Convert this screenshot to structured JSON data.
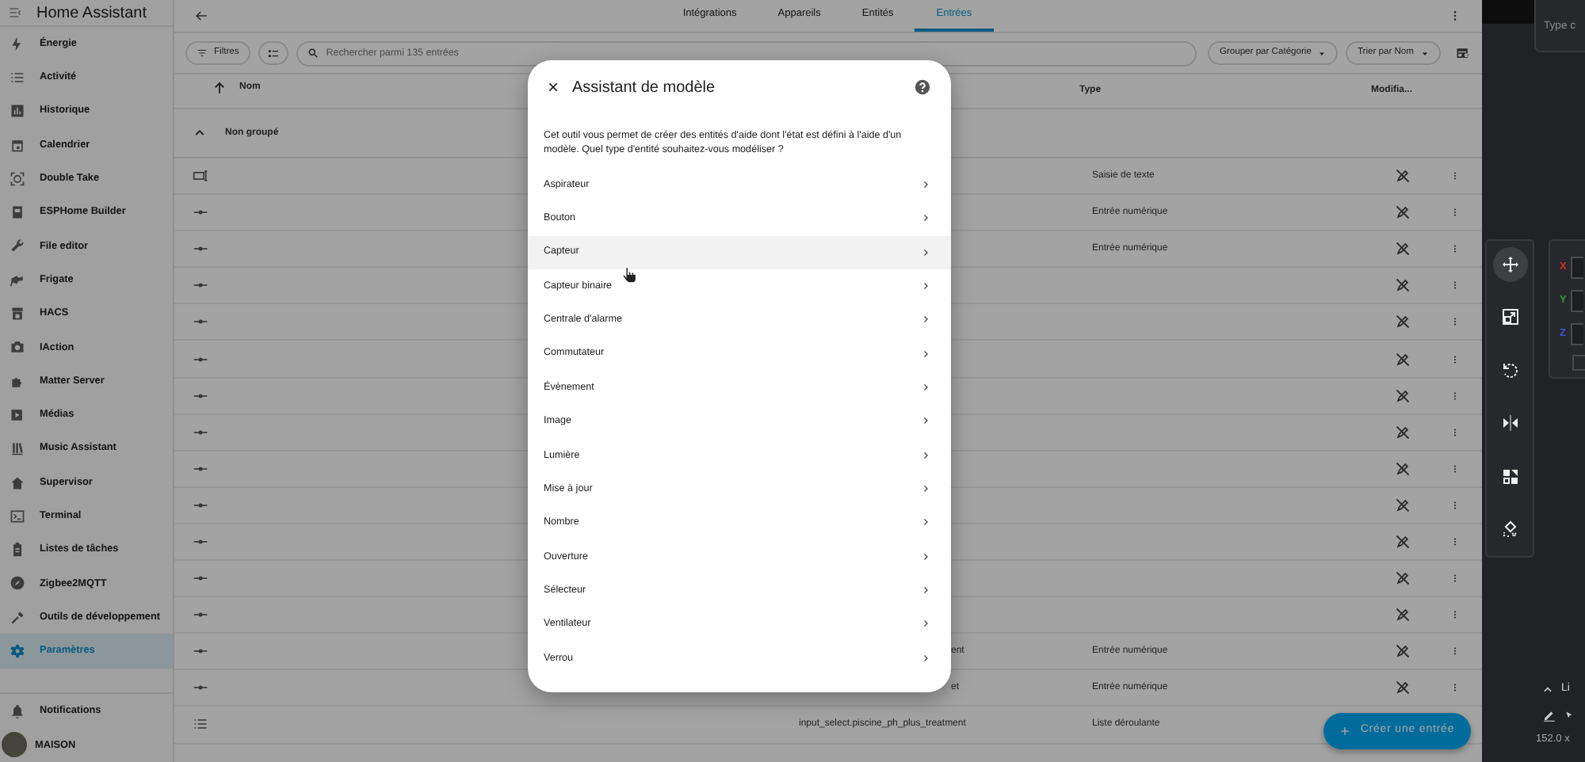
{
  "sidebar": {
    "title": "Home Assistant",
    "items": [
      {
        "label": "Énergie",
        "selected": false
      },
      {
        "label": "Activité",
        "selected": false
      },
      {
        "label": "Historique",
        "selected": false
      },
      {
        "label": "Calendrier",
        "selected": false
      },
      {
        "label": "Double Take",
        "selected": false
      },
      {
        "label": "ESPHome Builder",
        "selected": false
      },
      {
        "label": "File editor",
        "selected": false
      },
      {
        "label": "Frigate",
        "selected": false
      },
      {
        "label": "HACS",
        "selected": false
      },
      {
        "label": "IAction",
        "selected": false
      },
      {
        "label": "Matter Server",
        "selected": false
      },
      {
        "label": "Médias",
        "selected": false
      },
      {
        "label": "Music Assistant",
        "selected": false
      },
      {
        "label": "Supervisor",
        "selected": false
      },
      {
        "label": "Terminal",
        "selected": false
      },
      {
        "label": "Listes de tâches",
        "selected": false
      },
      {
        "label": "Zigbee2MQTT",
        "selected": false
      },
      {
        "label": "Outils de développement",
        "selected": false
      },
      {
        "label": "Paramètres",
        "selected": true
      }
    ],
    "notifications": "Notifications",
    "user": "MAISON"
  },
  "tabs": [
    {
      "label": "Intégrations",
      "selected": false
    },
    {
      "label": "Appareils",
      "selected": false
    },
    {
      "label": "Entités",
      "selected": false
    },
    {
      "label": "Entrées",
      "selected": true
    }
  ],
  "toolbar": {
    "filters": "Filtres",
    "search": {
      "placeholder": "Rechercher parmi 135 entrées"
    },
    "group_by": "Grouper par Catégorie",
    "sort_by": "Trier par Nom"
  },
  "table": {
    "columns": [
      {
        "label": "Nom",
        "sorted": true
      },
      {
        "label": "Type",
        "sorted": false
      },
      {
        "label": "Modifia...",
        "sorted": false
      }
    ],
    "group": {
      "label": "Non groupé",
      "expanded": true
    },
    "rows": [
      {
        "kind": "text",
        "type": "Saisie de texte"
      },
      {
        "kind": "number",
        "type": "Entrée numérique"
      },
      {
        "kind": "number",
        "type": "Entrée numérique"
      },
      {
        "kind": "number"
      },
      {
        "kind": "number"
      },
      {
        "kind": "number"
      },
      {
        "kind": "number"
      },
      {
        "kind": "number"
      },
      {
        "kind": "number"
      },
      {
        "kind": "number"
      },
      {
        "kind": "number"
      },
      {
        "kind": "number"
      },
      {
        "kind": "number"
      },
      {
        "kind": "number",
        "entity_id_tail": "ent",
        "type": "Entrée numérique"
      },
      {
        "kind": "number",
        "entity_id_tail": "et",
        "type": "Entrée numérique"
      },
      {
        "kind": "select",
        "entity_id": "input_select.piscine_ph_plus_treatment",
        "type": "Liste déroulante"
      }
    ]
  },
  "dialog": {
    "title": "Assistant de modèle",
    "description": "Cet outil vous permet de créer des entités d'aide dont l'état est défini à l'aide d'un modèle. Quel type d'entité souhaitez-vous modéliser ?",
    "options": [
      {
        "label": "Aspirateur",
        "highlighted": false
      },
      {
        "label": "Bouton",
        "highlighted": false
      },
      {
        "label": "Capteur",
        "highlighted": true
      },
      {
        "label": "Capteur binaire",
        "highlighted": false
      },
      {
        "label": "Centrale d'alarme",
        "highlighted": false
      },
      {
        "label": "Commutateur",
        "highlighted": false
      },
      {
        "label": "Évènement",
        "highlighted": false
      },
      {
        "label": "Image",
        "highlighted": false
      },
      {
        "label": "Lumière",
        "highlighted": false
      },
      {
        "label": "Mise à jour",
        "highlighted": false
      },
      {
        "label": "Nombre",
        "highlighted": false
      },
      {
        "label": "Ouverture",
        "highlighted": false
      },
      {
        "label": "Sélecteur",
        "highlighted": false
      },
      {
        "label": "Ventilateur",
        "highlighted": false
      },
      {
        "label": "Verrou",
        "highlighted": false
      }
    ]
  },
  "fab": "Créer une entrée",
  "right_panel": {
    "field": {
      "placeholder": "Type c"
    },
    "tools": [
      {
        "selected": true
      },
      {
        "selected": false
      },
      {
        "selected": false
      },
      {
        "selected": false
      },
      {
        "selected": false
      },
      {
        "selected": false
      }
    ],
    "axes": [
      {
        "label": "X",
        "color": "#d32f2f"
      },
      {
        "label": "Y",
        "color": "#2e9e3a"
      },
      {
        "label": "Z",
        "color": "#3f51d8"
      }
    ],
    "section": "Li",
    "size": "152.0 x"
  }
}
